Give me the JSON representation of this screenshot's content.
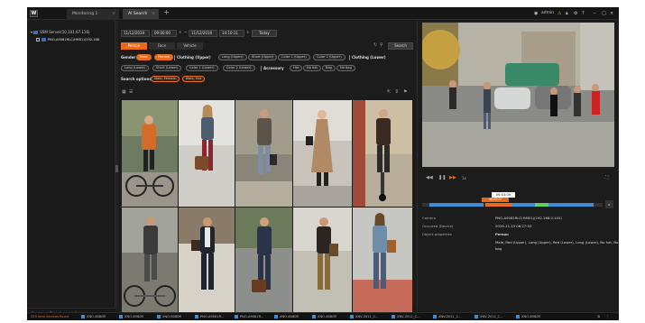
{
  "app": {
    "logo": "W",
    "tabs": [
      {
        "label": "Monitoring 1"
      },
      {
        "label": "AI Search"
      }
    ],
    "user": "admin"
  },
  "left": {
    "server": "SSM Server(10.101.67.116)",
    "device": "PNO-A9081RLC(HM01)(192.168",
    "bottom_tabs": [
      "Device",
      "Saved search lists"
    ]
  },
  "search": {
    "from_date": "11/12/2019",
    "from_time": "09:00:00",
    "to_date": "11/12/2019",
    "to_time": "14:10:11",
    "today_label": "Today",
    "search_label": "Search",
    "categories": [
      "Person",
      "Face",
      "Vehicle"
    ],
    "gender_label": "Gender",
    "gender_options": [
      "Male",
      "Female"
    ],
    "clothing_upper_label": "Clothing (Upper)",
    "clothing_upper_options": [
      "Long (Upper)",
      "Short (Upper)",
      "Color 1 (Upper)",
      "Color 2 (Upper)"
    ],
    "clothing_lower_label": "Clothing (Lower)",
    "clothing_lower_options": [
      "Long (Lower)",
      "Short (Lower)",
      "Color 1 (Lower)",
      "Color 2 (Lower)"
    ],
    "accessory_label": "Accessory",
    "accessory_options": [
      "Hat",
      "No hat",
      "Bag",
      "No bag"
    ],
    "search_option_label": "Search options:",
    "selected_options": [
      "Male, Female",
      "Male, Hat"
    ]
  },
  "detail": {
    "time_label": "06:03:09",
    "time_marker": "08:43:22",
    "speed": "1x",
    "camera_key": "Camera",
    "camera_val": "PNO-A9081RLC(HM01)(192.168.0.105)",
    "occurred_key": "Occurred (Device)",
    "occurred_val": "2019-11-13 06:27:52",
    "props_key": "Object properties",
    "props_title": "Person",
    "props_val1": "Male, Red (Upper), Long (Upper), Red (Lower), Long (Lower), No hat, No",
    "props_val2": "bag"
  },
  "status": {
    "msg": "359 item devices found",
    "items": [
      "XNO-6080R",
      "XNO-6080R",
      "XNO-6080R",
      "PNO-A9081R...",
      "PNO-A9081R...",
      "XNO-6080R",
      "XNO-6080R",
      "XNV-2011_C...",
      "XNV-2011_C...",
      "XNV-2011_C...",
      "XNV-2011_C...",
      "XNO-6080R"
    ]
  },
  "colors": {
    "accent": "#e86a1a",
    "bg": "#1c1c1c",
    "timeline_blue": "#3a8fd8",
    "timeline_green": "#66cc66"
  }
}
